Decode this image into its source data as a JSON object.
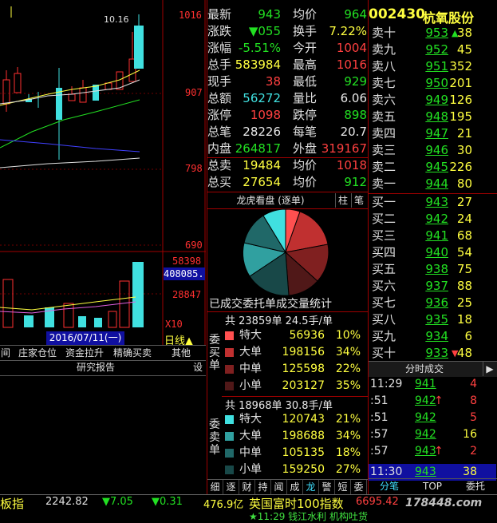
{
  "stock": {
    "code": "002430",
    "name": "杭氧股份"
  },
  "chart": {
    "price_labels": [
      "1016",
      "907",
      "798",
      "690"
    ],
    "high_note": "10.16",
    "vol_labels": [
      "58398",
      "28847"
    ],
    "vol_highlight": "408085.",
    "multiplier": "X10",
    "date": "2016/07/11(一)",
    "period": "日线▲"
  },
  "func_buttons": [
    "间",
    "庄家仓位",
    "资金拉升",
    "精确买卖",
    "其他"
  ],
  "research": {
    "label": "研究报告",
    "setting": "设"
  },
  "quote": [
    {
      "l1": "最新",
      "v1": "943",
      "c1": "grn",
      "l2": "均价",
      "v2": "964",
      "c2": "grn"
    },
    {
      "l1": "涨跌",
      "v1": "▼055",
      "c1": "grn",
      "l2": "换手",
      "v2": "7.22%",
      "c2": "yel"
    },
    {
      "l1": "涨幅",
      "v1": "-5.51%",
      "c1": "grn",
      "l2": "今开",
      "v2": "1004",
      "c2": "red"
    },
    {
      "l1": "总手",
      "v1": "583984",
      "c1": "yel",
      "l2": "最高",
      "v2": "1016",
      "c2": "red"
    },
    {
      "l1": "现手",
      "v1": "38",
      "c1": "red",
      "l2": "最低",
      "v2": "929",
      "c2": "grn"
    },
    {
      "l1": "总额",
      "v1": "56272",
      "c1": "cyn",
      "l2": "量比",
      "v2": "6.06",
      "c2": "wht"
    },
    {
      "l1": "涨停",
      "v1": "1098",
      "c1": "red",
      "l2": "跌停",
      "v2": "898",
      "c2": "grn"
    },
    {
      "l1": "总笔",
      "v1": "28226",
      "c1": "wht",
      "l2": "每笔",
      "v2": "20.7",
      "c2": "wht"
    },
    {
      "l1": "内盘",
      "v1": "264817",
      "c1": "grn",
      "l2": "外盘",
      "v2": "319167",
      "c2": "red"
    },
    {
      "l1": "总卖",
      "v1": "19484",
      "c1": "yel",
      "l2": "均价",
      "v2": "1018",
      "c2": "red"
    },
    {
      "l1": "总买",
      "v1": "27654",
      "c1": "yel",
      "l2": "均价",
      "v2": "912",
      "c2": "grn"
    }
  ],
  "dragon": {
    "title": "龙虎看盘 (逐单)",
    "tab1": "柱",
    "tab2": "笔",
    "subtitle": "已成交委托单成交量统计"
  },
  "buy_stats": {
    "side_label": "委买单",
    "summary": "共 23859单 24.5手/单",
    "rows": [
      {
        "name": "特大",
        "vol": "56936",
        "pct": "10%",
        "color": "#ff5050"
      },
      {
        "name": "大单",
        "vol": "198156",
        "pct": "34%",
        "color": "#c03030"
      },
      {
        "name": "中单",
        "vol": "125598",
        "pct": "22%",
        "color": "#802020"
      },
      {
        "name": "小单",
        "vol": "203127",
        "pct": "35%",
        "color": "#501818"
      }
    ]
  },
  "sell_stats": {
    "side_label": "委卖单",
    "summary": "共 18968单 30.8手/单",
    "rows": [
      {
        "name": "特大",
        "vol": "120743",
        "pct": "21%",
        "color": "#40e0e0"
      },
      {
        "name": "大单",
        "vol": "198688",
        "pct": "34%",
        "color": "#30a0a0"
      },
      {
        "name": "中单",
        "vol": "105135",
        "pct": "18%",
        "color": "#206868"
      },
      {
        "name": "小单",
        "vol": "159250",
        "pct": "27%",
        "color": "#184848"
      }
    ]
  },
  "bottom_tabs": [
    "细",
    "逐",
    "财",
    "持",
    "闻",
    "成",
    "龙",
    "警",
    "短",
    "委"
  ],
  "sell_orders": [
    {
      "label": "卖十",
      "price": "953",
      "arrow": "▲",
      "vol": "38"
    },
    {
      "label": "卖九",
      "price": "952",
      "arrow": "",
      "vol": "45"
    },
    {
      "label": "卖八",
      "price": "951",
      "arrow": "",
      "vol": "352"
    },
    {
      "label": "卖七",
      "price": "950",
      "arrow": "",
      "vol": "201"
    },
    {
      "label": "卖六",
      "price": "949",
      "arrow": "",
      "vol": "126"
    },
    {
      "label": "卖五",
      "price": "948",
      "arrow": "",
      "vol": "195"
    },
    {
      "label": "卖四",
      "price": "947",
      "arrow": "",
      "vol": "21"
    },
    {
      "label": "卖三",
      "price": "946",
      "arrow": "",
      "vol": "30"
    },
    {
      "label": "卖二",
      "price": "945",
      "arrow": "",
      "vol": "226"
    },
    {
      "label": "卖一",
      "price": "944",
      "arrow": "",
      "vol": "80"
    }
  ],
  "buy_orders": [
    {
      "label": "买一",
      "price": "943",
      "arrow": "",
      "vol": "27"
    },
    {
      "label": "买二",
      "price": "942",
      "arrow": "",
      "vol": "24"
    },
    {
      "label": "买三",
      "price": "941",
      "arrow": "",
      "vol": "68"
    },
    {
      "label": "买四",
      "price": "940",
      "arrow": "",
      "vol": "54"
    },
    {
      "label": "买五",
      "price": "938",
      "arrow": "",
      "vol": "75"
    },
    {
      "label": "买六",
      "price": "937",
      "arrow": "",
      "vol": "88"
    },
    {
      "label": "买七",
      "price": "936",
      "arrow": "",
      "vol": "25"
    },
    {
      "label": "买八",
      "price": "935",
      "arrow": "",
      "vol": "18"
    },
    {
      "label": "买九",
      "price": "934",
      "arrow": "",
      "vol": "6"
    },
    {
      "label": "买十",
      "price": "933",
      "arrow": "▼",
      "vol": "48"
    }
  ],
  "trades_header": "分时成交",
  "trades": [
    {
      "time": "11:29",
      "price": "941",
      "arrow": "",
      "vol": "4"
    },
    {
      "time": ":51",
      "price": "942",
      "arrow": "↑",
      "vol": "8"
    },
    {
      "time": ":51",
      "price": "942",
      "arrow": "",
      "vol": "5"
    },
    {
      "time": ":57",
      "price": "942",
      "arrow": "",
      "vol": "16"
    },
    {
      "time": ":57",
      "price": "943",
      "arrow": "↑",
      "vol": "2"
    },
    {
      "time": "11:30",
      "price": "943",
      "arrow": "",
      "vol": "38"
    }
  ],
  "right_tabs": [
    "分笔",
    "TOP",
    "委托"
  ],
  "ticker": {
    "left_name": "板指",
    "left_value": "2242.82",
    "left_change": "▼7.05",
    "left_pct": "▼0.31",
    "left_amount": "476.9亿",
    "right_name": "英国富时100指数",
    "right_value": "6695.42",
    "news": "★11:29 钱江水利 机构吐货"
  },
  "watermark": "178448.com"
}
